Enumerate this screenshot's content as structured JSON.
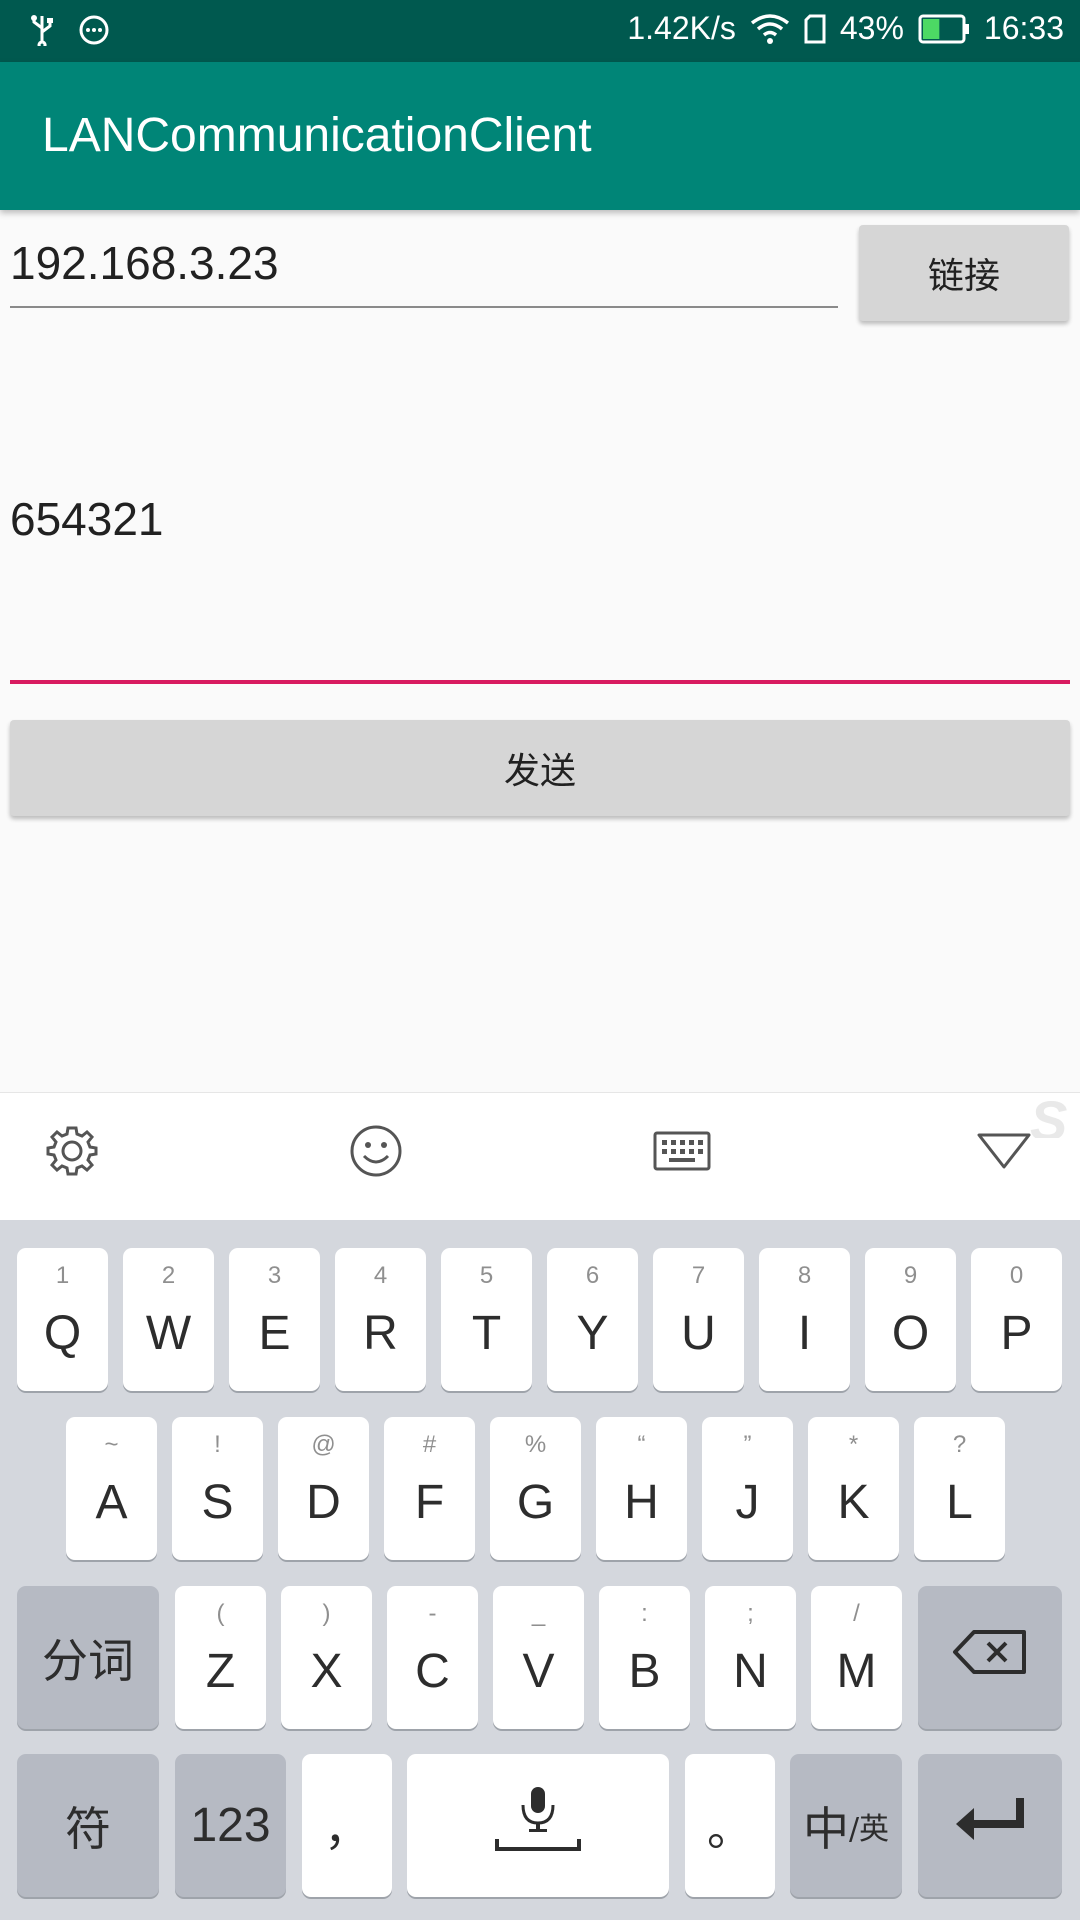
{
  "status_bar": {
    "network_speed": "1.42K/s",
    "battery_percent": "43%",
    "battery_level": 0.43,
    "time": "16:33",
    "icons": [
      "usb-icon",
      "message-icon",
      "wifi-icon",
      "sim-icon",
      "battery-icon"
    ]
  },
  "app_bar": {
    "title": "LANCommunicationClient"
  },
  "form": {
    "ip_value": "192.168.3.23",
    "connect_label": "链接",
    "message_value": "654321",
    "send_label": "发送"
  },
  "keyboard": {
    "toolbar": [
      "settings-icon",
      "emoji-icon",
      "keyboard-icon",
      "collapse-icon"
    ],
    "row1": [
      {
        "hint": "1",
        "label": "Q"
      },
      {
        "hint": "2",
        "label": "W"
      },
      {
        "hint": "3",
        "label": "E"
      },
      {
        "hint": "4",
        "label": "R"
      },
      {
        "hint": "5",
        "label": "T"
      },
      {
        "hint": "6",
        "label": "Y"
      },
      {
        "hint": "7",
        "label": "U"
      },
      {
        "hint": "8",
        "label": "I"
      },
      {
        "hint": "9",
        "label": "O"
      },
      {
        "hint": "0",
        "label": "P"
      }
    ],
    "row2": [
      {
        "hint": "~",
        "label": "A"
      },
      {
        "hint": "!",
        "label": "S"
      },
      {
        "hint": "@",
        "label": "D"
      },
      {
        "hint": "#",
        "label": "F"
      },
      {
        "hint": "%",
        "label": "G"
      },
      {
        "hint": "“",
        "label": "H"
      },
      {
        "hint": "”",
        "label": "J"
      },
      {
        "hint": "*",
        "label": "K"
      },
      {
        "hint": "?",
        "label": "L"
      }
    ],
    "row3": [
      {
        "hint": "(",
        "label": "Z"
      },
      {
        "hint": ")",
        "label": "X"
      },
      {
        "hint": "-",
        "label": "C"
      },
      {
        "hint": "_",
        "label": "V"
      },
      {
        "hint": ":",
        "label": "B"
      },
      {
        "hint": ";",
        "label": "N"
      },
      {
        "hint": "/",
        "label": "M"
      }
    ],
    "segment_label": "分词",
    "symbols_label": "符",
    "numbers_label": "123",
    "comma_label": "，",
    "period_label": "。",
    "lang_main": "中",
    "lang_sub": "/英"
  }
}
